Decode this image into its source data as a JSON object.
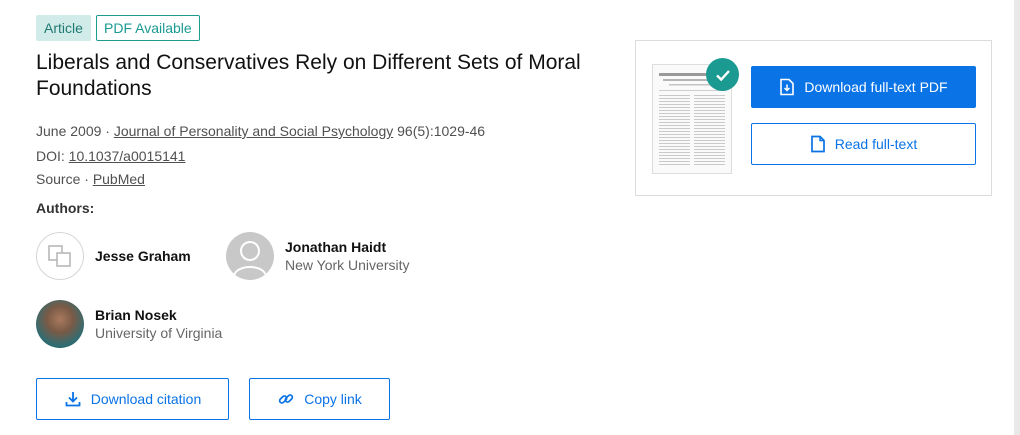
{
  "badges": {
    "article": "Article",
    "pdf": "PDF Available"
  },
  "title": "Liberals and Conservatives Rely on Different Sets of Moral Foundations",
  "meta": {
    "date": "June 2009",
    "sep": " · ",
    "journal": "Journal of Personality and Social Psychology",
    "volume": " 96(5):1029-46",
    "doi_label": "DOI: ",
    "doi": "10.1037/a0015141",
    "source_label": "Source · ",
    "source": "PubMed"
  },
  "authors_label": "Authors:",
  "authors": [
    {
      "name": "Jesse Graham",
      "affiliation": ""
    },
    {
      "name": "Jonathan Haidt",
      "affiliation": "New York University"
    },
    {
      "name": "Brian Nosek",
      "affiliation": "University of Virginia"
    }
  ],
  "actions": {
    "download_citation": "Download citation",
    "copy_link": "Copy link"
  },
  "panel": {
    "download_pdf": "Download full-text PDF",
    "read_full": "Read full-text"
  },
  "colors": {
    "accent": "#0a73e6",
    "teal": "#1b9a92",
    "badge_bg": "#d0ebe8"
  },
  "icons": [
    "download-icon",
    "file-icon",
    "link-icon",
    "check-icon",
    "user-placeholder-icon",
    "copy-squares-icon"
  ]
}
